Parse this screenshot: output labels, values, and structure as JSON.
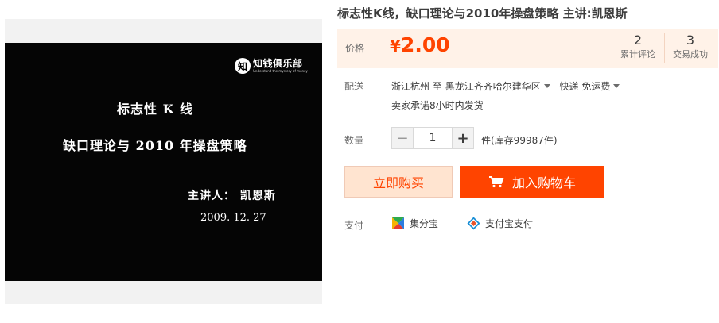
{
  "product_image": {
    "logo_mark": "知",
    "logo_text": "知钱俱乐部",
    "logo_tagline": "Understand the mystery of money",
    "slide_lines": [
      "标志性 K 线",
      "缺口理论与 2010 年操盘策略",
      "主讲人：  凯恩斯",
      "2009. 12. 27"
    ]
  },
  "title": "标志性K线，缺口理论与2010年操盘策略 主讲:凯恩斯",
  "price": {
    "label": "价格",
    "currency": "¥",
    "value": "2.00",
    "color": "#ff4400"
  },
  "stats": [
    {
      "count": "2",
      "label": "累计评论"
    },
    {
      "count": "3",
      "label": "交易成功"
    }
  ],
  "shipping": {
    "label": "配送",
    "from": "浙江杭州",
    "to_word": "至",
    "destination": "黑龙江齐齐哈尔建华区",
    "method": "快递 免运费",
    "promise": "卖家承诺8小时内发货"
  },
  "quantity": {
    "label": "数量",
    "minus": "−",
    "value": "1",
    "plus": "+",
    "stock": "件(库存99987件)"
  },
  "actions": {
    "buy_now": "立即购买",
    "add_to_cart": "加入购物车"
  },
  "payment": {
    "label": "支付",
    "methods": [
      {
        "name": "集分宝",
        "icon": "jifenbao-icon"
      },
      {
        "name": "支付宝支付",
        "icon": "alipay-icon"
      }
    ]
  }
}
